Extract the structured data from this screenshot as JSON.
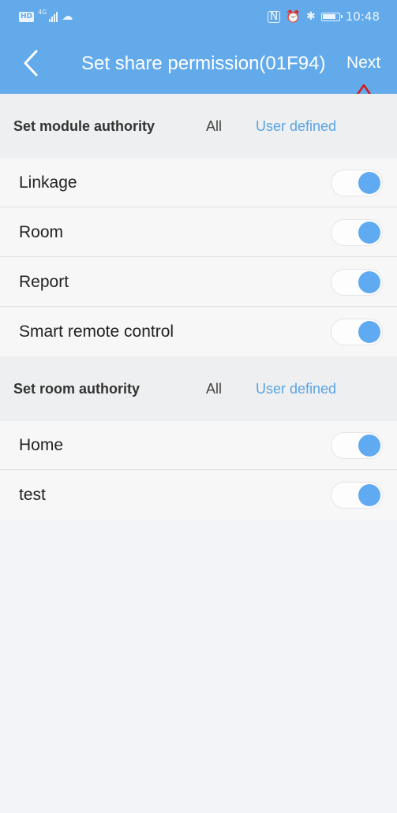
{
  "status_bar": {
    "hd_badge": "HD",
    "network": "4G",
    "icons": [
      "nfc-icon",
      "alarm-icon",
      "bluetooth-icon",
      "battery-icon"
    ],
    "time": "10:48"
  },
  "header": {
    "title": "Set share permission(01F94)",
    "next_label": "Next",
    "back_icon": "chevron-left-icon",
    "accent": "#63aaeb"
  },
  "annotation": {
    "color": "#d51a1a",
    "icon": "up-arrow-icon"
  },
  "module_section": {
    "title": "Set module authority",
    "option_all": "All",
    "option_user_defined": "User defined",
    "items": [
      {
        "label": "Linkage",
        "enabled": true
      },
      {
        "label": "Room",
        "enabled": true
      },
      {
        "label": "Report",
        "enabled": true
      },
      {
        "label": "Smart remote control",
        "enabled": true
      }
    ]
  },
  "room_section": {
    "title": "Set room authority",
    "option_all": "All",
    "option_user_defined": "User defined",
    "items": [
      {
        "label": "Home",
        "enabled": true
      },
      {
        "label": "test",
        "enabled": true
      }
    ]
  },
  "colors": {
    "toggle_on": "#60aaf2",
    "link_blue": "#5aa4e4"
  }
}
